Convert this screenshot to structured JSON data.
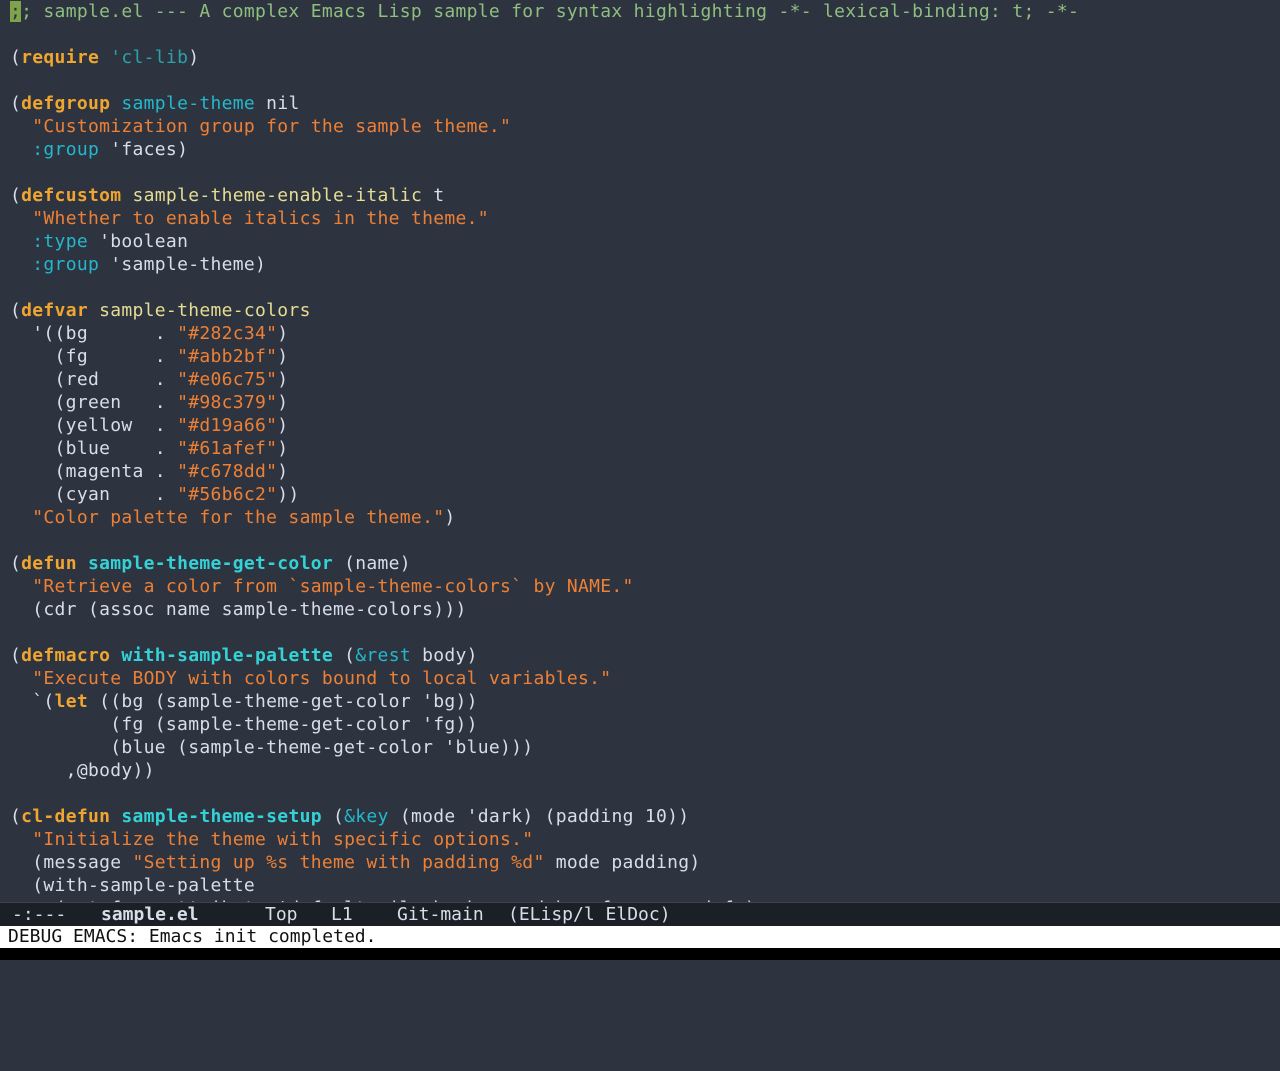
{
  "editor": {
    "lines": [
      [
        [
          "cm",
          ";; sample.el --- A complex Emacs Lisp sample for syntax highlighting -*- lexical-binding: t; -*-"
        ]
      ],
      [],
      [
        [
          "tx",
          "("
        ],
        [
          "kw",
          "require"
        ],
        [
          "tx",
          " "
        ],
        [
          "sym",
          "'cl-lib"
        ],
        [
          "tx",
          ")"
        ]
      ],
      [],
      [
        [
          "tx",
          "("
        ],
        [
          "kw",
          "defgroup"
        ],
        [
          "tx",
          " "
        ],
        [
          "ty",
          "sample-theme"
        ],
        [
          "tx",
          " nil"
        ]
      ],
      [
        [
          "tx",
          "  "
        ],
        [
          "doc",
          "\"Customization group for the sample theme.\""
        ]
      ],
      [
        [
          "tx",
          "  "
        ],
        [
          "kwd",
          ":group"
        ],
        [
          "tx",
          " 'faces)"
        ]
      ],
      [],
      [
        [
          "tx",
          "("
        ],
        [
          "kw",
          "defcustom"
        ],
        [
          "tx",
          " "
        ],
        [
          "var",
          "sample-theme-enable-italic"
        ],
        [
          "tx",
          " t"
        ]
      ],
      [
        [
          "tx",
          "  "
        ],
        [
          "doc",
          "\"Whether to enable italics in the theme.\""
        ]
      ],
      [
        [
          "tx",
          "  "
        ],
        [
          "kwd",
          ":type"
        ],
        [
          "tx",
          " 'boolean"
        ]
      ],
      [
        [
          "tx",
          "  "
        ],
        [
          "kwd",
          ":group"
        ],
        [
          "tx",
          " 'sample-theme)"
        ]
      ],
      [],
      [
        [
          "tx",
          "("
        ],
        [
          "kw",
          "defvar"
        ],
        [
          "tx",
          " "
        ],
        [
          "var",
          "sample-theme-colors"
        ]
      ],
      [
        [
          "tx",
          "  '((bg      . "
        ],
        [
          "str",
          "\"#282c34\""
        ],
        [
          "tx",
          ")"
        ]
      ],
      [
        [
          "tx",
          "    (fg      . "
        ],
        [
          "str",
          "\"#abb2bf\""
        ],
        [
          "tx",
          ")"
        ]
      ],
      [
        [
          "tx",
          "    (red     . "
        ],
        [
          "str",
          "\"#e06c75\""
        ],
        [
          "tx",
          ")"
        ]
      ],
      [
        [
          "tx",
          "    (green   . "
        ],
        [
          "str",
          "\"#98c379\""
        ],
        [
          "tx",
          ")"
        ]
      ],
      [
        [
          "tx",
          "    (yellow  . "
        ],
        [
          "str",
          "\"#d19a66\""
        ],
        [
          "tx",
          ")"
        ]
      ],
      [
        [
          "tx",
          "    (blue    . "
        ],
        [
          "str",
          "\"#61afef\""
        ],
        [
          "tx",
          ")"
        ]
      ],
      [
        [
          "tx",
          "    (magenta . "
        ],
        [
          "str",
          "\"#c678dd\""
        ],
        [
          "tx",
          ")"
        ]
      ],
      [
        [
          "tx",
          "    (cyan    . "
        ],
        [
          "str",
          "\"#56b6c2\""
        ],
        [
          "tx",
          "))"
        ]
      ],
      [
        [
          "tx",
          "  "
        ],
        [
          "doc",
          "\"Color palette for the sample theme.\""
        ],
        [
          "tx",
          ")"
        ]
      ],
      [],
      [
        [
          "tx",
          "("
        ],
        [
          "kw",
          "defun"
        ],
        [
          "tx",
          " "
        ],
        [
          "fn",
          "sample-theme-get-color"
        ],
        [
          "tx",
          " (name)"
        ]
      ],
      [
        [
          "tx",
          "  "
        ],
        [
          "doc",
          "\"Retrieve a color from `sample-theme-colors` by NAME.\""
        ]
      ],
      [
        [
          "tx",
          "  (cdr (assoc name sample-theme-colors)))"
        ]
      ],
      [],
      [
        [
          "tx",
          "("
        ],
        [
          "kw",
          "defmacro"
        ],
        [
          "tx",
          " "
        ],
        [
          "fn",
          "with-sample-palette"
        ],
        [
          "tx",
          " ("
        ],
        [
          "ty",
          "&rest"
        ],
        [
          "tx",
          " body)"
        ]
      ],
      [
        [
          "tx",
          "  "
        ],
        [
          "doc",
          "\"Execute BODY with colors bound to local variables.\""
        ]
      ],
      [
        [
          "tx",
          "  `("
        ],
        [
          "kw",
          "let"
        ],
        [
          "tx",
          " ((bg (sample-theme-get-color 'bg))"
        ]
      ],
      [
        [
          "tx",
          "         (fg (sample-theme-get-color 'fg))"
        ]
      ],
      [
        [
          "tx",
          "         (blue (sample-theme-get-color 'blue)))"
        ]
      ],
      [
        [
          "tx",
          "     ,@body))"
        ]
      ],
      [],
      [
        [
          "tx",
          "("
        ],
        [
          "kw",
          "cl-defun"
        ],
        [
          "tx",
          " "
        ],
        [
          "fn",
          "sample-theme-setup"
        ],
        [
          "tx",
          " ("
        ],
        [
          "ty",
          "&key"
        ],
        [
          "tx",
          " (mode 'dark) (padding 10))"
        ]
      ],
      [
        [
          "tx",
          "  "
        ],
        [
          "doc",
          "\"Initialize the theme with specific options.\""
        ]
      ],
      [
        [
          "tx",
          "  (message "
        ],
        [
          "str",
          "\"Setting up %s theme with padding %d\""
        ],
        [
          "tx",
          " mode padding)"
        ]
      ],
      [
        [
          "tx",
          "  (with-sample-palette"
        ]
      ],
      [
        [
          "tx",
          "    (set-face-attribute 'default nil :background bg :foreground fg)"
        ]
      ]
    ]
  },
  "modeline": {
    "status": "-:---",
    "buffer_name": "sample.el",
    "position": "Top",
    "line": "L1",
    "vc": "Git-main",
    "modes": "(ELisp/l ElDoc)"
  },
  "minibuffer": {
    "message": "DEBUG EMACS: Emacs init completed."
  },
  "colors": {
    "background": "#2d3440",
    "modeline_bg": "#1b1f26",
    "minibuffer_bg": "#ffffff",
    "keyword": "#f0a530",
    "function_name": "#33d2d6",
    "string": "#ee8035",
    "comment": "#8fbf7f",
    "cursor": "#7fa34a"
  }
}
